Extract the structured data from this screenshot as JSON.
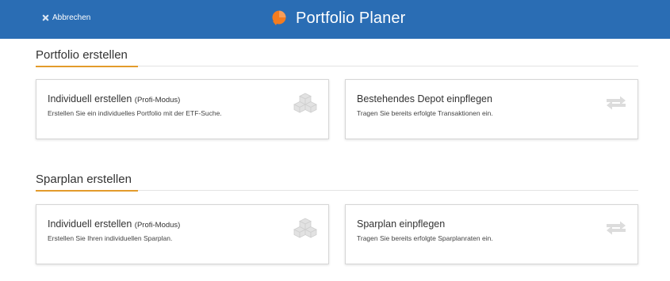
{
  "header": {
    "cancel_label": "Abbrechen",
    "app_title": "Portfolio Planer"
  },
  "sections": [
    {
      "title": "Portfolio erstellen",
      "cards": [
        {
          "title": "Individuell erstellen",
          "subtitle": "(Profi-Modus)",
          "description": "Erstellen Sie ein individuelles Portfolio mit der ETF-Suche.",
          "icon": "cubes-icon"
        },
        {
          "title": "Bestehendes Depot einpflegen",
          "subtitle": "",
          "description": "Tragen Sie bereits erfolgte Transaktionen ein.",
          "icon": "exchange-arrows-icon"
        }
      ]
    },
    {
      "title": "Sparplan erstellen",
      "cards": [
        {
          "title": "Individuell erstellen",
          "subtitle": "(Profi-Modus)",
          "description": "Erstellen Sie Ihren individuellen Sparplan.",
          "icon": "cubes-icon"
        },
        {
          "title": "Sparplan einpflegen",
          "subtitle": "",
          "description": "Tragen Sie bereits erfolgte Sparplanraten ein.",
          "icon": "exchange-arrows-icon"
        }
      ]
    }
  ],
  "colors": {
    "header_bg": "#2a6db4",
    "accent": "#e39b2b",
    "logo": "#f47c20",
    "icon_gray": "#dcdcdc"
  }
}
